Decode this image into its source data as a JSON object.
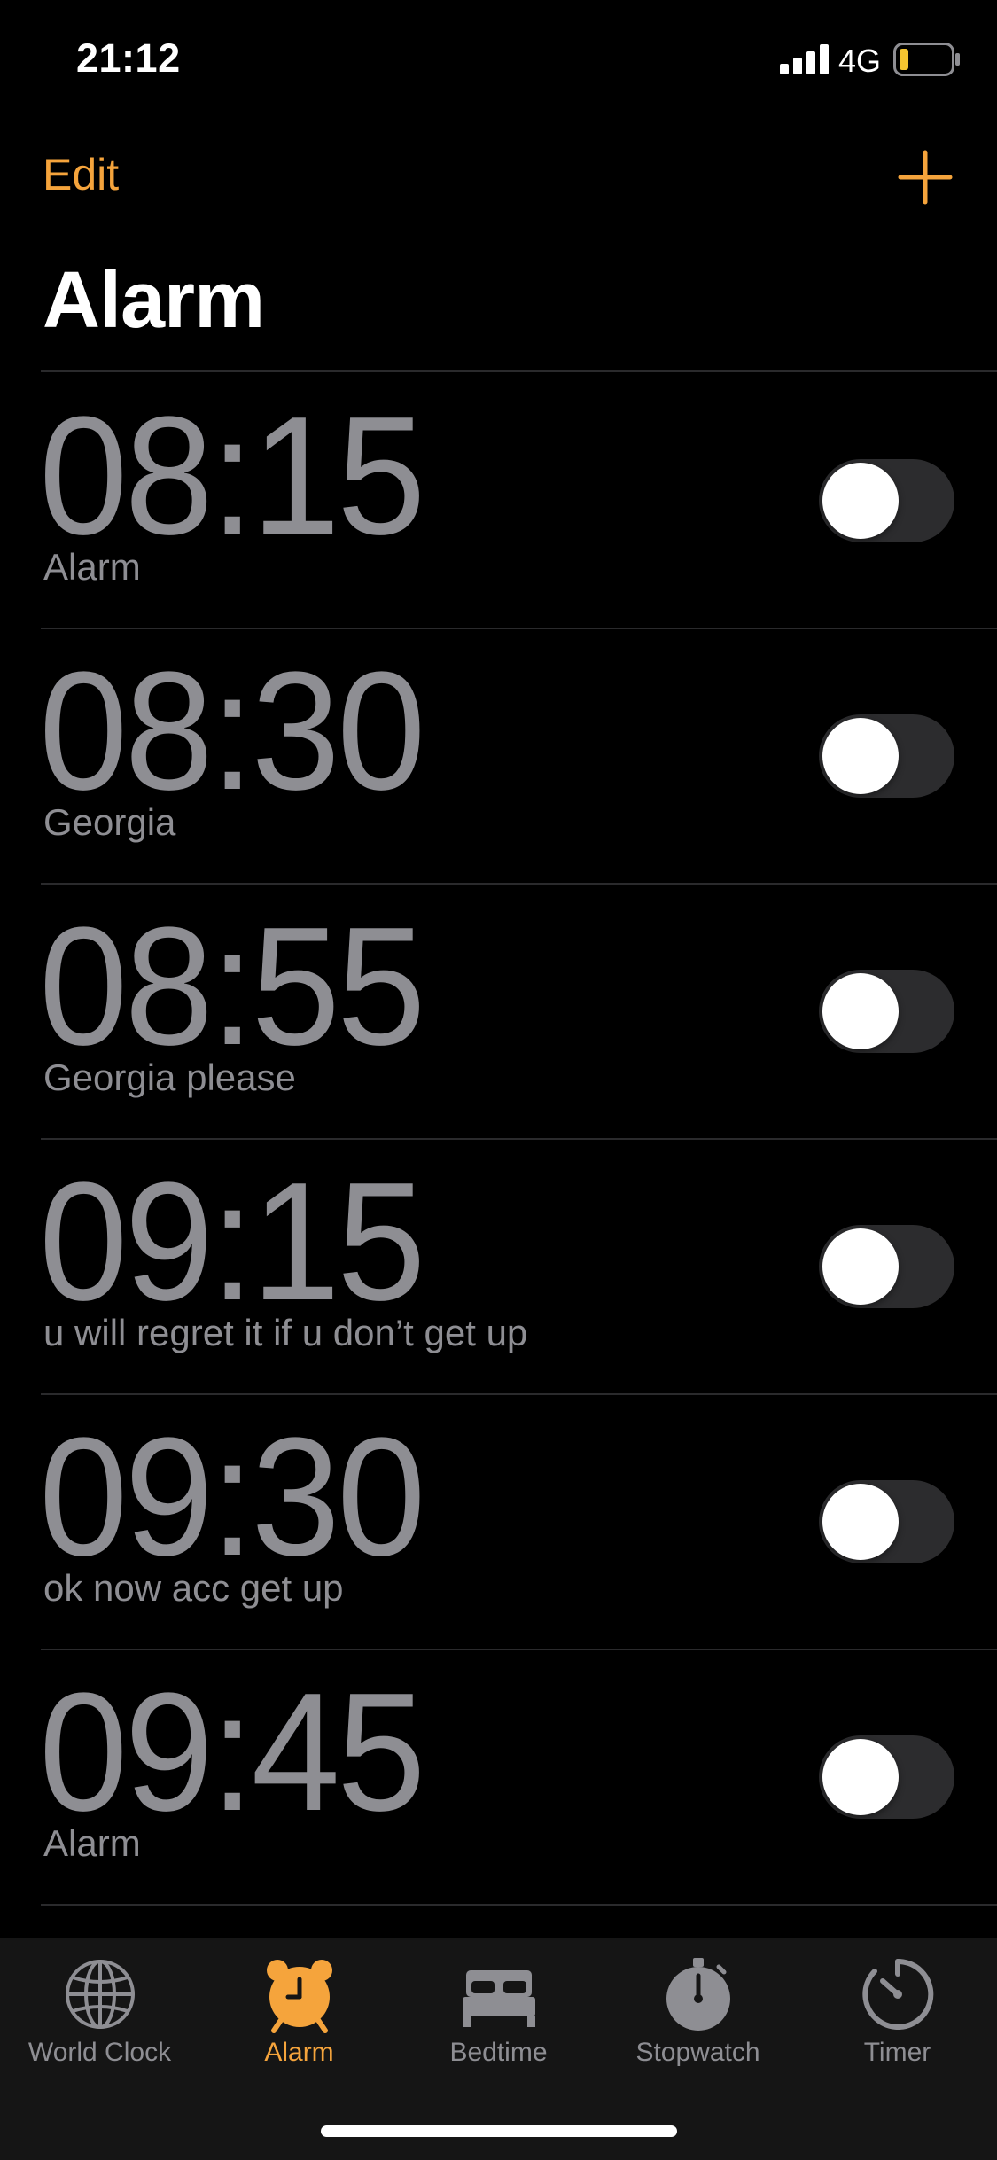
{
  "status_bar": {
    "time": "21:12",
    "network": "4G",
    "signal_icon": "cellular-signal-icon",
    "battery_icon": "battery-low-icon",
    "battery_color": "#f4c430"
  },
  "nav": {
    "edit_label": "Edit",
    "add_icon": "plus-icon",
    "title": "Alarm"
  },
  "accent_color": "#f5a43c",
  "alarms": [
    {
      "time": "08:15",
      "label": "Alarm",
      "enabled": false
    },
    {
      "time": "08:30",
      "label": "Georgia",
      "enabled": false
    },
    {
      "time": "08:55",
      "label": "Georgia please",
      "enabled": false
    },
    {
      "time": "09:15",
      "label": "u will regret it if u don’t get up",
      "enabled": false
    },
    {
      "time": "09:30",
      "label": "ok now acc get up",
      "enabled": false
    },
    {
      "time": "09:45",
      "label": "Alarm",
      "enabled": false
    }
  ],
  "tabs": [
    {
      "label": "World Clock",
      "icon": "globe-icon",
      "active": false
    },
    {
      "label": "Alarm",
      "icon": "alarm-clock-icon",
      "active": true
    },
    {
      "label": "Bedtime",
      "icon": "bed-icon",
      "active": false
    },
    {
      "label": "Stopwatch",
      "icon": "stopwatch-icon",
      "active": false
    },
    {
      "label": "Timer",
      "icon": "timer-icon",
      "active": false
    }
  ]
}
